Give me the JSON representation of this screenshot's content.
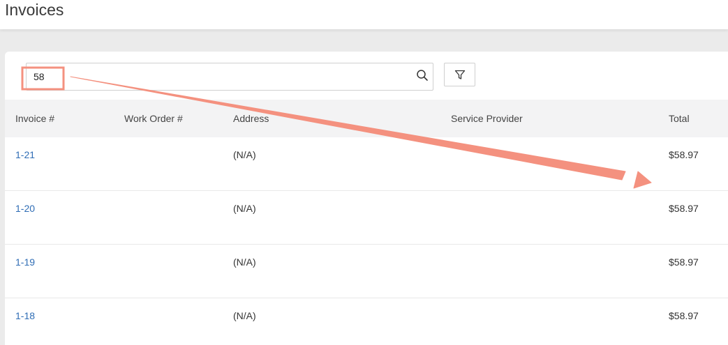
{
  "page": {
    "title": "Invoices"
  },
  "search": {
    "value": "58",
    "placeholder": ""
  },
  "table": {
    "columns": [
      "Invoice #",
      "Work Order #",
      "Address",
      "Service Provider",
      "Total"
    ],
    "rows": [
      {
        "invoice": "1-21",
        "work_order": "",
        "address": "(N/A)",
        "service_provider": "",
        "total": "$58.97"
      },
      {
        "invoice": "1-20",
        "work_order": "",
        "address": "(N/A)",
        "service_provider": "",
        "total": "$58.97"
      },
      {
        "invoice": "1-19",
        "work_order": "",
        "address": "(N/A)",
        "service_provider": "",
        "total": "$58.97"
      },
      {
        "invoice": "1-18",
        "work_order": "",
        "address": "(N/A)",
        "service_provider": "",
        "total": "$58.97"
      }
    ]
  },
  "icons": {
    "search": "search-icon",
    "filter": "filter-icon"
  },
  "colors": {
    "link": "#2f6db5",
    "annotation": "#f4917f",
    "header_bg": "#f3f3f4",
    "page_bg": "#ebebeb"
  }
}
